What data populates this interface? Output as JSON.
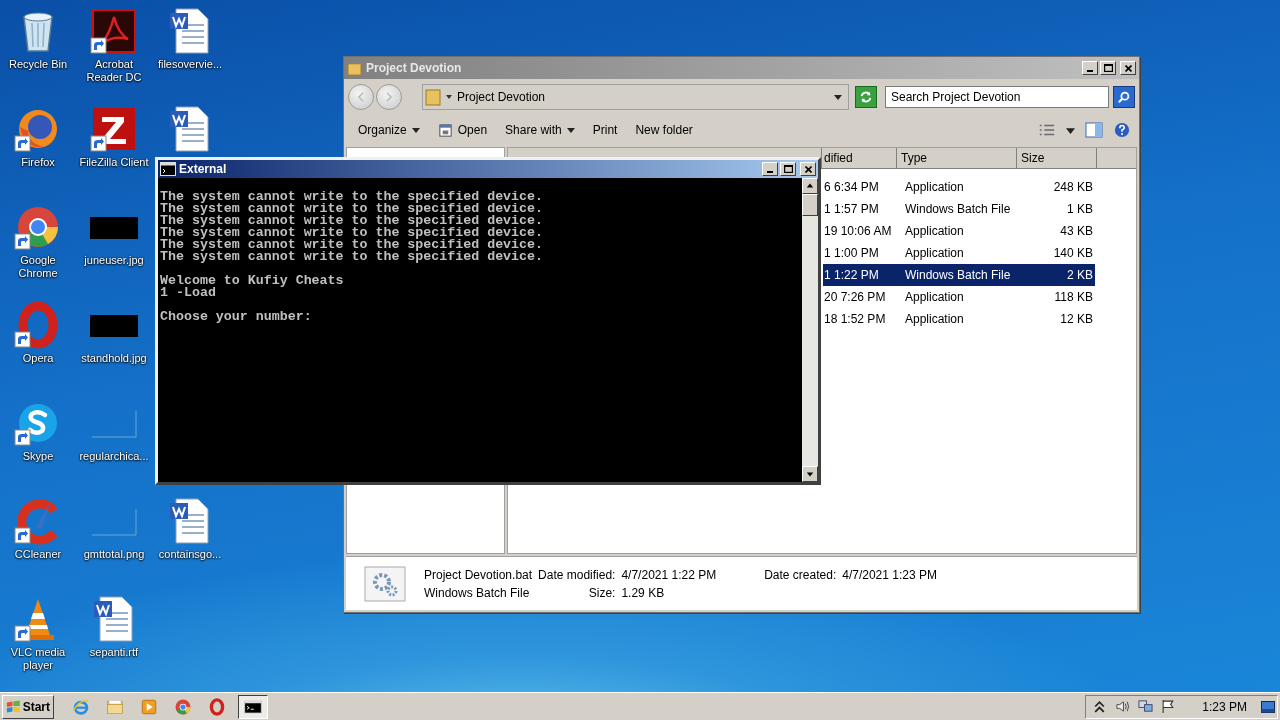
{
  "desktop_columns": [
    [
      {
        "kind": "recycle-bin",
        "label": "Recycle Bin",
        "shortcut": false
      },
      {
        "kind": "firefox",
        "label": "Firefox",
        "shortcut": true
      },
      {
        "kind": "chrome",
        "label": "Google Chrome",
        "shortcut": true
      },
      {
        "kind": "opera",
        "label": "Opera",
        "shortcut": true
      },
      {
        "kind": "skype",
        "label": "Skype",
        "shortcut": true
      },
      {
        "kind": "ccleaner",
        "label": "CCleaner",
        "shortcut": true
      },
      {
        "kind": "vlc",
        "label": "VLC media player",
        "shortcut": true
      }
    ],
    [
      {
        "kind": "acrobat",
        "label": "Acrobat Reader DC",
        "shortcut": true
      },
      {
        "kind": "filezilla",
        "label": "FileZilla Client",
        "shortcut": true
      },
      {
        "kind": "dark-thumb",
        "label": "juneuser.jpg",
        "shortcut": false
      },
      {
        "kind": "dark-thumb",
        "label": "standhold.jpg",
        "shortcut": false
      },
      {
        "kind": "blank-thumb",
        "label": "regularchica...",
        "shortcut": false
      },
      {
        "kind": "blank-thumb",
        "label": "gmttotal.png",
        "shortcut": false
      },
      {
        "kind": "word",
        "label": "sepanti.rtf",
        "shortcut": false
      }
    ],
    [
      {
        "kind": "word",
        "label": "filesovervie...",
        "shortcut": false
      },
      {
        "kind": "word",
        "shortcut": false
      },
      {
        "kind": "word",
        "label": "containsgo...",
        "shortcut": false
      }
    ]
  ],
  "explorer": {
    "title": "Project Devotion",
    "breadcrumb": "Project Devotion",
    "search_placeholder": "Search Project Devotion",
    "toolbar": [
      {
        "label": "Organize",
        "kind": "plain",
        "dropdown": true
      },
      {
        "label": "Open",
        "kind": "open",
        "dropdown": false
      },
      {
        "label": "Share with",
        "kind": "plain",
        "dropdown": true
      },
      {
        "label": "Print",
        "kind": "plain",
        "dropdown": false
      },
      {
        "label": "New folder",
        "kind": "plain",
        "dropdown": false
      }
    ],
    "columns": [
      "dified",
      "Type",
      "Size"
    ],
    "rows": [
      {
        "modified": "6 6:34 PM",
        "type": "Application",
        "size": "248 KB",
        "selected": false
      },
      {
        "modified": "1 1:57 PM",
        "type": "Windows Batch File",
        "size": "1 KB",
        "selected": false
      },
      {
        "modified": "19 10:06 AM",
        "type": "Application",
        "size": "43 KB",
        "selected": false
      },
      {
        "modified": "1 1:00 PM",
        "type": "Application",
        "size": "140 KB",
        "selected": false
      },
      {
        "modified": "1 1:22 PM",
        "type": "Windows Batch File",
        "size": "2 KB",
        "selected": true
      },
      {
        "modified": "20 7:26 PM",
        "type": "Application",
        "size": "118 KB",
        "selected": false
      },
      {
        "modified": "18 1:52 PM",
        "type": "Application",
        "size": "12 KB",
        "selected": false
      }
    ],
    "details": {
      "name": "Project Devotion.bat",
      "type": "Windows Batch File",
      "modified_label": "Date modified:",
      "modified": "4/7/2021 1:22 PM",
      "size_label": "Size:",
      "size": "1.29 KB",
      "created_label": "Date created:",
      "created": "4/7/2021 1:23 PM"
    }
  },
  "console": {
    "title": "External",
    "blocks": [
      [
        "The system cannot write to the specified device.",
        "The system cannot write to the specified device.",
        "The system cannot write to the specified device.",
        "The system cannot write to the specified device.",
        "The system cannot write to the specified device.",
        "The system cannot write to the specified device."
      ],
      [
        "Welcome to Kufiy Cheats",
        "1 -Load"
      ],
      [
        "Choose your number:"
      ]
    ]
  },
  "taskbar": {
    "start": "Start",
    "quick_launch": [
      {
        "kind": "ie"
      },
      {
        "kind": "folder"
      },
      {
        "kind": "media-player"
      },
      {
        "kind": "chrome"
      },
      {
        "kind": "opera"
      }
    ],
    "tasks": [
      {
        "kind": "console",
        "active": true
      }
    ],
    "clock": "1:23 PM"
  }
}
